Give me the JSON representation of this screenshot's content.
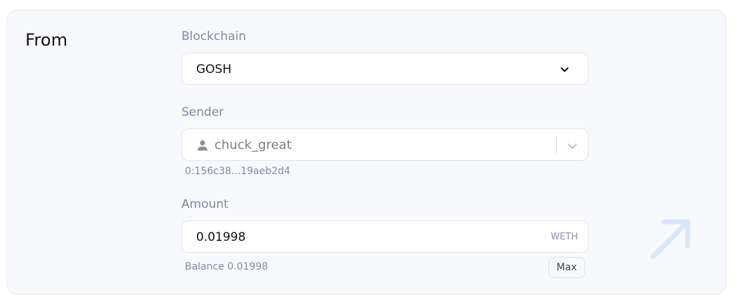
{
  "section": {
    "title": "From"
  },
  "blockchain": {
    "label": "Blockchain",
    "selected": "GOSH",
    "icon": "chevron-down-icon"
  },
  "sender": {
    "label": "Sender",
    "value": "chuck_great",
    "address": "0:156c38...19aeb2d4",
    "icon": "user-icon",
    "dropdown_icon": "chevron-down-icon"
  },
  "amount": {
    "label": "Amount",
    "value": "0.01998",
    "unit": "WETH",
    "balance_text": "Balance 0.01998",
    "max_label": "Max"
  },
  "decoration": {
    "icon": "arrow-up-right-icon",
    "color": "#dbe6fd"
  },
  "colors": {
    "card_background": "#f8f9fc",
    "label": "#7c8aa5",
    "text": "#111111"
  }
}
